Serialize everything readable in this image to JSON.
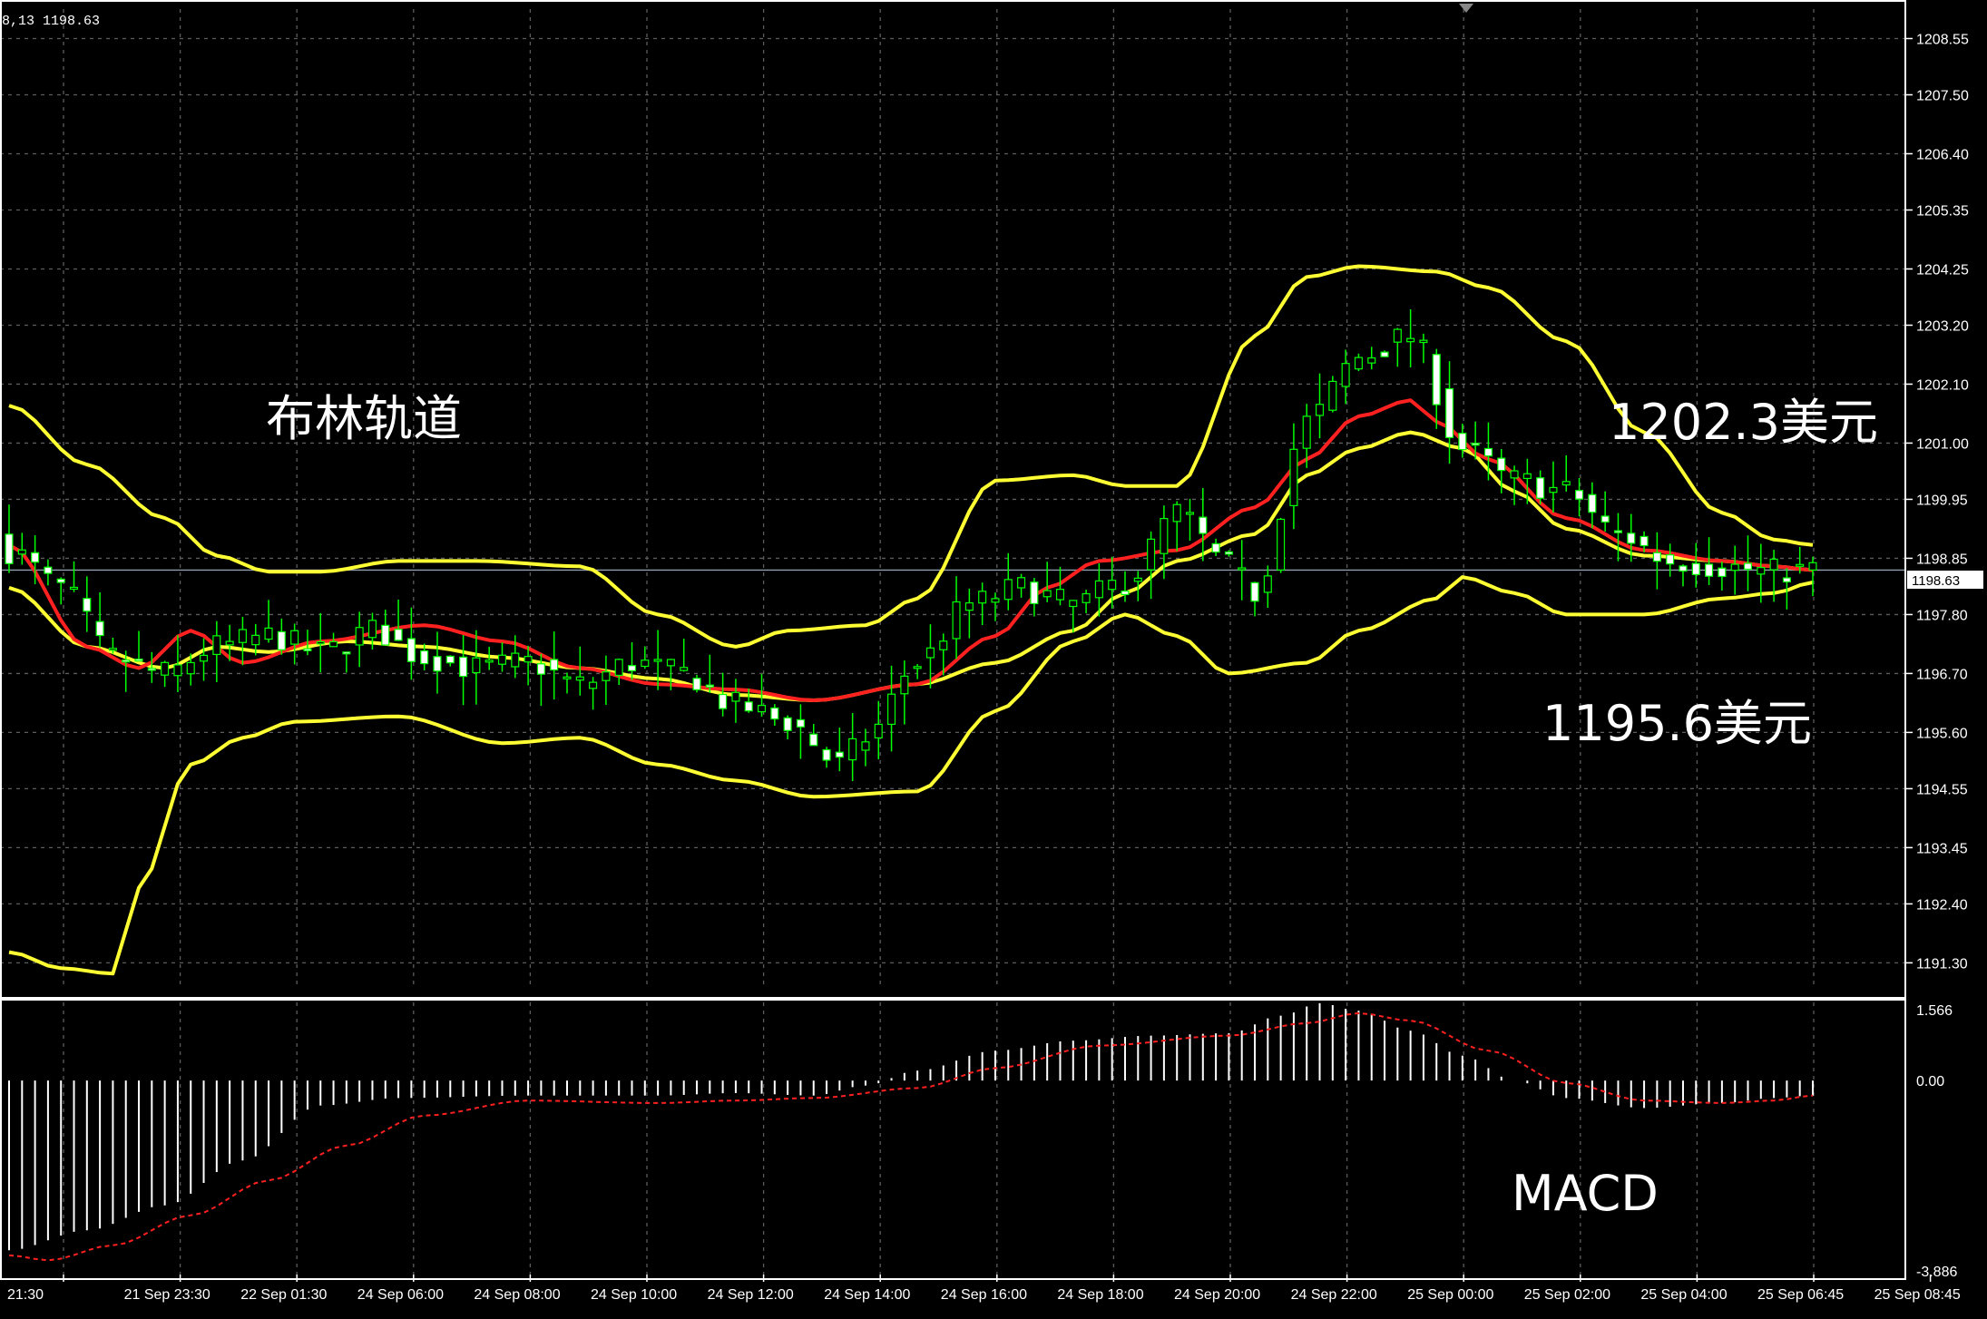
{
  "header": {
    "text": "8,13 1198.63"
  },
  "colors": {
    "background": "#000000",
    "grid": "#5c5c5c",
    "axis": "#ffffff",
    "bull_candle": "#00ff00",
    "bear_candle_body": "#ffffff",
    "bollinger": "#ffff33",
    "moving_average": "#ff2020",
    "macd_histogram": "#ffffff",
    "macd_signal": "#ff2020"
  },
  "annotations": {
    "indicator_label": "布林轨道",
    "upper_level": "1202.3美元",
    "lower_level": "1195.6美元",
    "macd_label": "MACD"
  },
  "chart_data": [
    {
      "type": "candlestick",
      "name": "price",
      "current_price": "1198.63",
      "ylim": [
        1190.9,
        1209.1
      ],
      "y_ticks": [
        "1208.55",
        "1207.50",
        "1206.40",
        "1205.35",
        "1204.25",
        "1203.20",
        "1202.10",
        "1201.00",
        "1199.95",
        "1198.85",
        "1197.80",
        "1196.70",
        "1195.60",
        "1194.55",
        "1193.45",
        "1192.40",
        "1191.30"
      ],
      "x_labels": [
        "21:30",
        "21 Sep 23:30",
        "22 Sep 01:30",
        "24 Sep 06:00",
        "24 Sep 08:00",
        "24 Sep 10:00",
        "24 Sep 12:00",
        "24 Sep 14:00",
        "24 Sep 16:00",
        "24 Sep 18:00",
        "24 Sep 20:00",
        "24 Sep 22:00",
        "25 Sep 00:00",
        "25 Sep 02:00",
        "25 Sep 04:00",
        "25 Sep 06:45",
        "25 Sep 08:45"
      ],
      "bars": 140,
      "close_keypoints": [
        [
          0,
          1199.0
        ],
        [
          4,
          1198.3
        ],
        [
          8,
          1197.0
        ],
        [
          12,
          1196.7
        ],
        [
          16,
          1197.2
        ],
        [
          20,
          1197.4
        ],
        [
          24,
          1197.1
        ],
        [
          28,
          1197.5
        ],
        [
          32,
          1197.0
        ],
        [
          36,
          1196.8
        ],
        [
          40,
          1196.9
        ],
        [
          44,
          1196.5
        ],
        [
          48,
          1196.9
        ],
        [
          52,
          1196.7
        ],
        [
          56,
          1196.1
        ],
        [
          60,
          1195.8
        ],
        [
          64,
          1195.0
        ],
        [
          66,
          1195.5
        ],
        [
          70,
          1196.9
        ],
        [
          74,
          1198.0
        ],
        [
          78,
          1198.3
        ],
        [
          82,
          1198.0
        ],
        [
          86,
          1198.4
        ],
        [
          90,
          1199.7
        ],
        [
          94,
          1198.7
        ],
        [
          96,
          1198.2
        ],
        [
          100,
          1201.4
        ],
        [
          104,
          1202.6
        ],
        [
          108,
          1203.0
        ],
        [
          112,
          1200.9
        ],
        [
          116,
          1200.3
        ],
        [
          120,
          1200.1
        ],
        [
          124,
          1199.3
        ],
        [
          128,
          1198.8
        ],
        [
          132,
          1198.7
        ],
        [
          136,
          1198.6
        ],
        [
          139,
          1198.63
        ]
      ],
      "bollinger_upper_keypoints": [
        [
          0,
          1201.7
        ],
        [
          6,
          1200.6
        ],
        [
          12,
          1199.6
        ],
        [
          16,
          1198.9
        ],
        [
          20,
          1198.6
        ],
        [
          24,
          1198.6
        ],
        [
          30,
          1198.8
        ],
        [
          36,
          1198.8
        ],
        [
          44,
          1198.7
        ],
        [
          50,
          1197.8
        ],
        [
          56,
          1197.2
        ],
        [
          60,
          1197.5
        ],
        [
          66,
          1197.6
        ],
        [
          70,
          1198.1
        ],
        [
          76,
          1200.3
        ],
        [
          82,
          1200.4
        ],
        [
          86,
          1200.2
        ],
        [
          90,
          1200.2
        ],
        [
          96,
          1203.0
        ],
        [
          100,
          1204.1
        ],
        [
          104,
          1204.3
        ],
        [
          110,
          1204.2
        ],
        [
          114,
          1203.9
        ],
        [
          120,
          1202.9
        ],
        [
          126,
          1201.2
        ],
        [
          132,
          1199.7
        ],
        [
          136,
          1199.2
        ],
        [
          139,
          1199.1
        ]
      ],
      "bollinger_middle_keypoints": [
        [
          0,
          1198.3
        ],
        [
          6,
          1197.2
        ],
        [
          12,
          1196.8
        ],
        [
          16,
          1197.2
        ],
        [
          20,
          1197.1
        ],
        [
          26,
          1197.3
        ],
        [
          32,
          1197.2
        ],
        [
          38,
          1197.0
        ],
        [
          44,
          1196.8
        ],
        [
          50,
          1196.6
        ],
        [
          56,
          1196.3
        ],
        [
          62,
          1196.2
        ],
        [
          70,
          1196.5
        ],
        [
          76,
          1196.9
        ],
        [
          82,
          1197.5
        ],
        [
          86,
          1198.2
        ],
        [
          90,
          1198.8
        ],
        [
          96,
          1199.3
        ],
        [
          100,
          1200.4
        ],
        [
          104,
          1200.9
        ],
        [
          108,
          1201.2
        ],
        [
          112,
          1200.9
        ],
        [
          116,
          1200.1
        ],
        [
          120,
          1199.4
        ],
        [
          126,
          1198.9
        ],
        [
          132,
          1198.8
        ],
        [
          136,
          1198.7
        ],
        [
          139,
          1198.63
        ]
      ],
      "bollinger_lower_keypoints": [
        [
          0,
          1191.5
        ],
        [
          4,
          1191.2
        ],
        [
          8,
          1191.1
        ],
        [
          10,
          1192.7
        ],
        [
          14,
          1195.0
        ],
        [
          18,
          1195.5
        ],
        [
          22,
          1195.8
        ],
        [
          30,
          1195.9
        ],
        [
          38,
          1195.4
        ],
        [
          44,
          1195.5
        ],
        [
          50,
          1195.0
        ],
        [
          56,
          1194.7
        ],
        [
          62,
          1194.4
        ],
        [
          70,
          1194.5
        ],
        [
          76,
          1196.0
        ],
        [
          82,
          1197.3
        ],
        [
          86,
          1197.8
        ],
        [
          90,
          1197.4
        ],
        [
          94,
          1196.7
        ],
        [
          100,
          1196.9
        ],
        [
          104,
          1197.5
        ],
        [
          110,
          1198.1
        ],
        [
          112,
          1198.5
        ],
        [
          116,
          1198.2
        ],
        [
          120,
          1197.8
        ],
        [
          126,
          1197.8
        ],
        [
          132,
          1198.1
        ],
        [
          136,
          1198.2
        ],
        [
          139,
          1198.4
        ]
      ],
      "moving_average_keypoints": [
        [
          0,
          1199.1
        ],
        [
          6,
          1197.2
        ],
        [
          10,
          1196.8
        ],
        [
          14,
          1197.5
        ],
        [
          18,
          1196.9
        ],
        [
          24,
          1197.3
        ],
        [
          32,
          1197.6
        ],
        [
          38,
          1197.3
        ],
        [
          44,
          1196.8
        ],
        [
          50,
          1196.5
        ],
        [
          56,
          1196.4
        ],
        [
          62,
          1196.2
        ],
        [
          70,
          1196.5
        ],
        [
          76,
          1197.4
        ],
        [
          80,
          1198.3
        ],
        [
          84,
          1198.8
        ],
        [
          90,
          1199.0
        ],
        [
          96,
          1199.8
        ],
        [
          100,
          1200.7
        ],
        [
          104,
          1201.5
        ],
        [
          108,
          1201.8
        ],
        [
          110,
          1201.4
        ],
        [
          114,
          1200.7
        ],
        [
          120,
          1199.6
        ],
        [
          126,
          1199.0
        ],
        [
          132,
          1198.8
        ],
        [
          136,
          1198.7
        ],
        [
          139,
          1198.63
        ]
      ]
    },
    {
      "type": "bar",
      "name": "MACD",
      "ylim": [
        -3.886,
        1.566
      ],
      "y_ticks": [
        "1.566",
        "0.00",
        "-3.886"
      ],
      "histogram_keypoints": [
        [
          0,
          -3.4
        ],
        [
          6,
          -3.0
        ],
        [
          12,
          -2.5
        ],
        [
          18,
          -1.6
        ],
        [
          24,
          -0.5
        ],
        [
          30,
          -0.35
        ],
        [
          40,
          -0.3
        ],
        [
          50,
          -0.3
        ],
        [
          56,
          -0.25
        ],
        [
          62,
          -0.3
        ],
        [
          66,
          -0.1
        ],
        [
          70,
          0.2
        ],
        [
          76,
          0.6
        ],
        [
          82,
          0.8
        ],
        [
          88,
          0.9
        ],
        [
          94,
          0.95
        ],
        [
          98,
          1.3
        ],
        [
          101,
          1.55
        ],
        [
          104,
          1.4
        ],
        [
          108,
          1.0
        ],
        [
          112,
          0.5
        ],
        [
          116,
          0.0
        ],
        [
          120,
          -0.35
        ],
        [
          126,
          -0.55
        ],
        [
          132,
          -0.45
        ],
        [
          136,
          -0.35
        ],
        [
          139,
          -0.3
        ]
      ],
      "signal_keypoints": [
        [
          0,
          -3.5
        ],
        [
          3,
          -3.6
        ],
        [
          8,
          -3.3
        ],
        [
          14,
          -2.7
        ],
        [
          20,
          -2.0
        ],
        [
          26,
          -1.3
        ],
        [
          32,
          -0.7
        ],
        [
          40,
          -0.4
        ],
        [
          50,
          -0.45
        ],
        [
          56,
          -0.4
        ],
        [
          62,
          -0.35
        ],
        [
          70,
          -0.15
        ],
        [
          76,
          0.25
        ],
        [
          84,
          0.7
        ],
        [
          94,
          0.9
        ],
        [
          100,
          1.15
        ],
        [
          104,
          1.35
        ],
        [
          108,
          1.2
        ],
        [
          114,
          0.6
        ],
        [
          120,
          -0.05
        ],
        [
          126,
          -0.4
        ],
        [
          132,
          -0.45
        ],
        [
          136,
          -0.4
        ],
        [
          139,
          -0.3
        ]
      ]
    }
  ]
}
